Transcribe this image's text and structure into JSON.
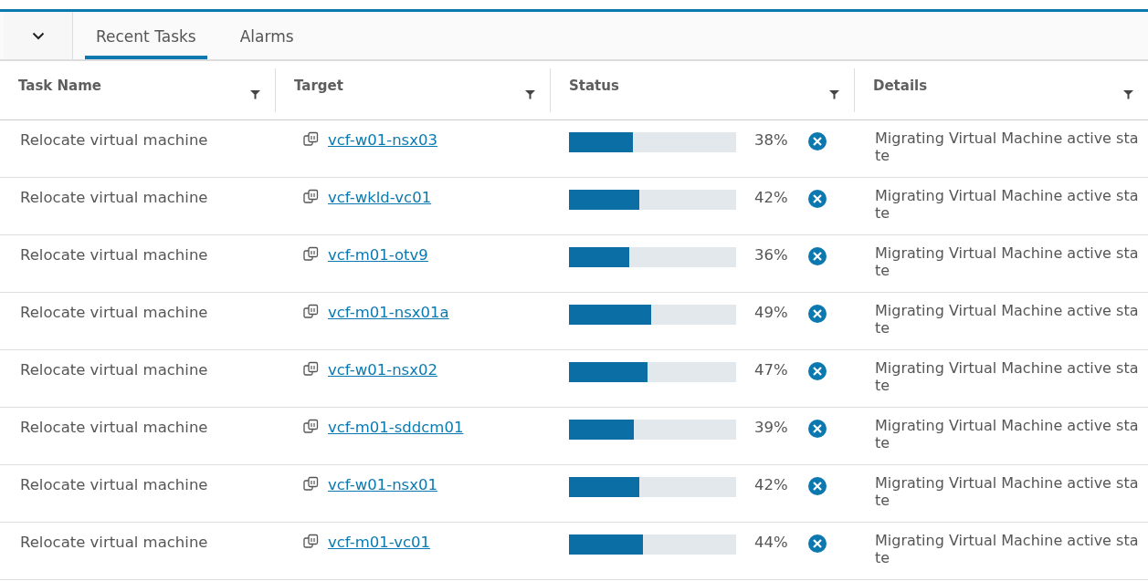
{
  "tabs": [
    {
      "label": "Recent Tasks",
      "selected": true
    },
    {
      "label": "Alarms",
      "selected": false
    }
  ],
  "table": {
    "columns": [
      "Task Name",
      "Target",
      "Status",
      "Details"
    ],
    "rows": [
      {
        "task_name": "Relocate virtual machine",
        "target": "vcf-w01-nsx03",
        "level": 0.38,
        "percent": "38%",
        "details": "Migrating Virtual Machine active state"
      },
      {
        "task_name": "Relocate virtual machine",
        "target": "vcf-wkld-vc01",
        "level": 0.42,
        "percent": "42%",
        "details": "Migrating Virtual Machine active state"
      },
      {
        "task_name": "Relocate virtual machine",
        "target": "vcf-m01-otv9",
        "level": 0.36,
        "percent": "36%",
        "details": "Migrating Virtual Machine active state"
      },
      {
        "task_name": "Relocate virtual machine",
        "target": "vcf-m01-nsx01a",
        "level": 0.49,
        "percent": "49%",
        "details": "Migrating Virtual Machine active state"
      },
      {
        "task_name": "Relocate virtual machine",
        "target": "vcf-w01-nsx02",
        "level": 0.47,
        "percent": "47%",
        "details": "Migrating Virtual Machine active state"
      },
      {
        "task_name": "Relocate virtual machine",
        "target": "vcf-m01-sddcm01",
        "level": 0.39,
        "percent": "39%",
        "details": "Migrating Virtual Machine active state"
      },
      {
        "task_name": "Relocate virtual machine",
        "target": "vcf-w01-nsx01",
        "level": 0.42,
        "percent": "42%",
        "details": "Migrating Virtual Machine active state"
      },
      {
        "task_name": "Relocate virtual machine",
        "target": "vcf-m01-vc01",
        "level": 0.44,
        "percent": "44%",
        "details": "Migrating Virtual Machine active state"
      }
    ]
  }
}
